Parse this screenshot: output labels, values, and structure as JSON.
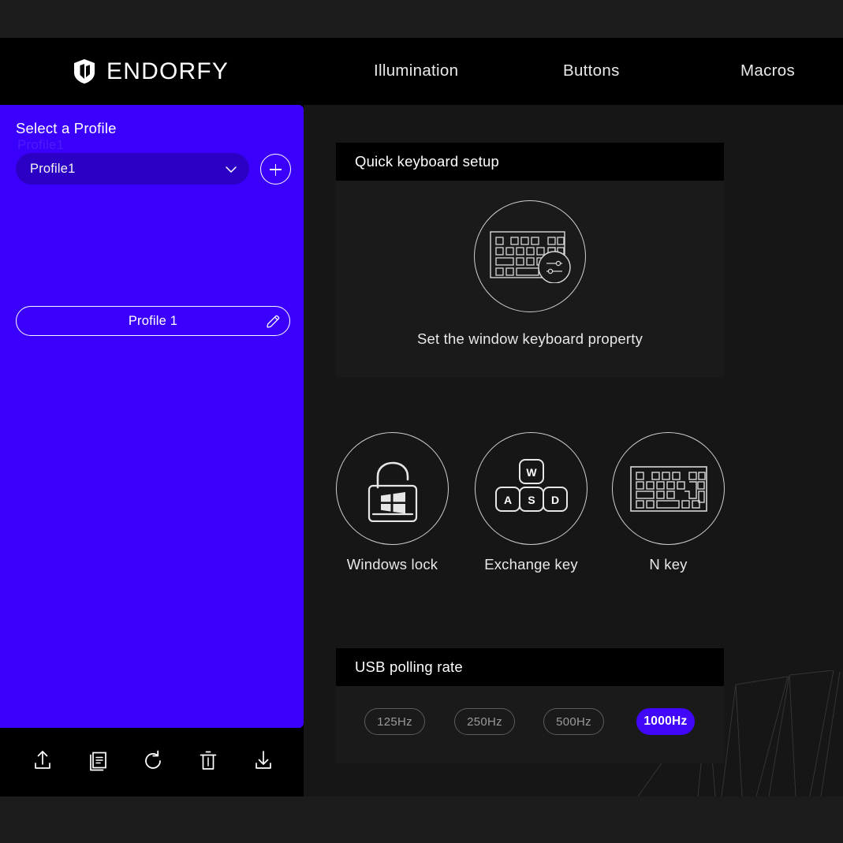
{
  "app": {
    "brand_name": "ENDORFY",
    "brand_icon": "shield-logo-icon"
  },
  "nav": {
    "items": [
      {
        "label": "Illumination",
        "icon": "illumination-tab"
      },
      {
        "label": "Buttons",
        "icon": "buttons-tab"
      },
      {
        "label": "Macros",
        "icon": "macros-tab"
      }
    ]
  },
  "sidebar": {
    "title": "Select a Profile",
    "floating_label": "Profile1",
    "dropdown": {
      "value": "Profile1",
      "chevron_icon": "chevron-down-icon"
    },
    "add_button": {
      "label": "+",
      "icon": "plus-icon"
    },
    "profiles": [
      {
        "name": "Profile 1",
        "edit_icon": "pencil-icon"
      }
    ],
    "toolbar": [
      {
        "icon": "upload-icon",
        "label": "Import"
      },
      {
        "icon": "copy-icon",
        "label": "Duplicate"
      },
      {
        "icon": "refresh-icon",
        "label": "Reset"
      },
      {
        "icon": "trash-icon",
        "label": "Delete"
      },
      {
        "icon": "download-icon",
        "label": "Export"
      }
    ]
  },
  "main": {
    "quick_setup": {
      "header": "Quick keyboard setup",
      "icon": "keyboard-settings-icon",
      "caption": "Set the window keyboard property"
    },
    "features": [
      {
        "label": "Windows lock",
        "icon": "windows-lock-icon"
      },
      {
        "label": "Exchange key",
        "icon": "wasd-keys-icon"
      },
      {
        "label": "N key",
        "icon": "keyboard-icon"
      }
    ],
    "polling": {
      "header": "USB polling rate",
      "options": [
        {
          "label": "125Hz",
          "selected": false
        },
        {
          "label": "250Hz",
          "selected": false
        },
        {
          "label": "500Hz",
          "selected": false
        },
        {
          "label": "1000Hz",
          "selected": true
        }
      ]
    },
    "decoration_icon": "angled-lines-decoration",
    "barcode_icon": "barcode-decoration"
  },
  "colors": {
    "accent": "#3B00FB",
    "accent_button": "#4007FB",
    "window_bg": "#000000",
    "content_bg": "#161616",
    "card_bg": "#1A1A1A",
    "page_bg": "#1C1C1C",
    "text": "#FFFFFF",
    "muted_text": "#9A9A9A"
  }
}
